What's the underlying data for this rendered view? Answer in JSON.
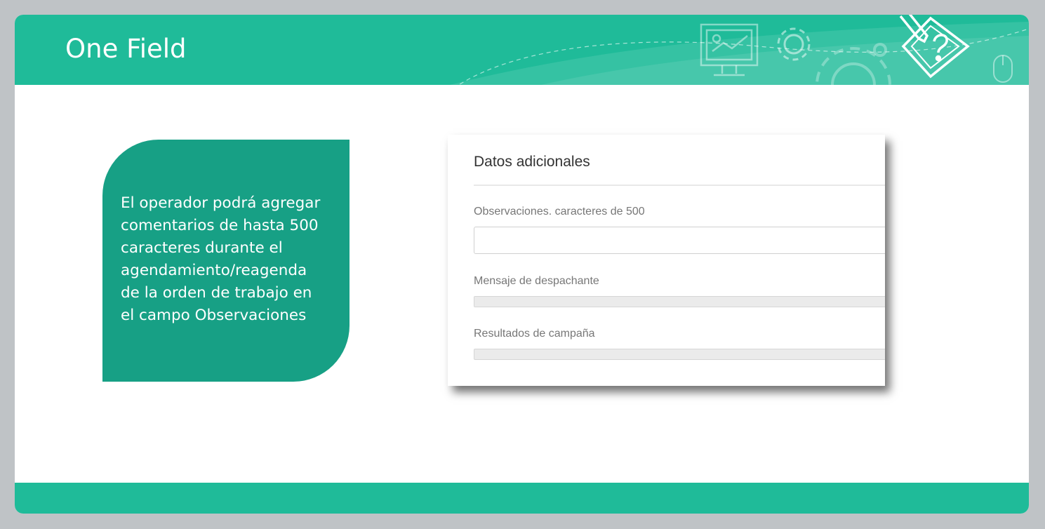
{
  "slide": {
    "title": "One Field",
    "accent_color": "#1fbb99",
    "callout_color": "#17a085"
  },
  "callout": {
    "lines": [
      "El operador podrá agregar",
      "comentarios de hasta 500",
      "caracteres durante el",
      "agendamiento/reagenda",
      "de la orden de trabajo en",
      "el campo Observaciones"
    ]
  },
  "form": {
    "section_title": "Datos adicionales",
    "observaciones": {
      "label": "Observaciones. caracteres de 500",
      "value": ""
    },
    "mensaje": {
      "label": "Mensaje de despachante"
    },
    "resultados": {
      "label": "Resultados de campaña"
    }
  },
  "header_icons": [
    "presentation-board-icon",
    "gear-icon",
    "large-gear-icon",
    "pencil-question-icon",
    "mouse-icon"
  ]
}
